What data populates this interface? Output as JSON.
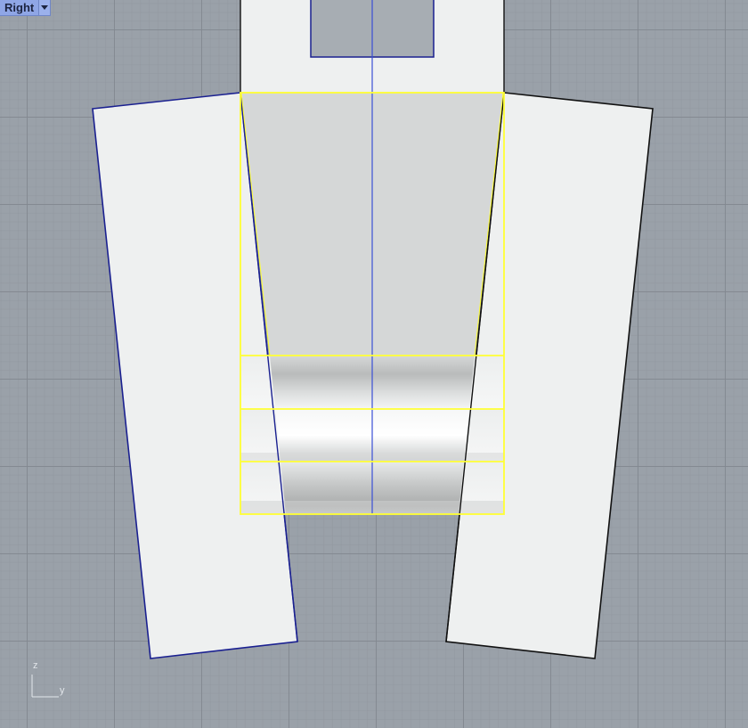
{
  "viewport": {
    "name": "Right",
    "menu_icon": "chevron-down-icon"
  },
  "axis_indicator": {
    "vertical_axis": "z",
    "horizontal_axis": "y"
  },
  "colors": {
    "background": "#9aa1a9",
    "object_fill": "#eef0f0",
    "selection": "#ffff33",
    "curve_blue": "#1a2090",
    "edge_black": "#111111",
    "centerline": "#3a4fd6",
    "tab": "#8fa6e6"
  }
}
